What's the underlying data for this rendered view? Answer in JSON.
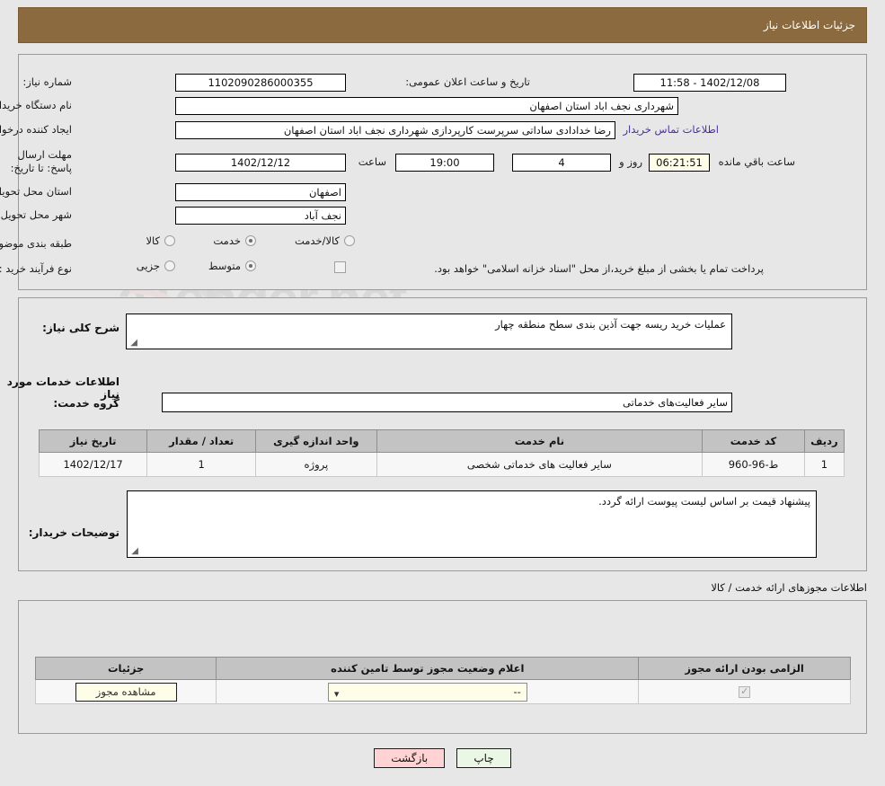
{
  "header": {
    "title": "جزئیات اطلاعات نیاز"
  },
  "top_form": {
    "need_number_label": "شماره نیاز:",
    "need_number_value": "1102090286000355",
    "announce_label": "تاریخ و ساعت اعلان عمومی:",
    "announce_value": "1402/12/08 - 11:58",
    "buyer_org_label": "نام دستگاه خریدار:",
    "buyer_org_value": "شهرداری نجف اباد استان اصفهان",
    "creator_label": "ایجاد کننده درخواست:",
    "creator_value": "رضا خدادادی ساداتی سرپرست  کارپردازی شهرداری نجف اباد استان اصفهان",
    "contact_link": "اطلاعات تماس خریدار",
    "deadline_label": "مهلت ارسال پاسخ: تا تاریخ:",
    "deadline_date": "1402/12/12",
    "hour_label": "ساعت",
    "deadline_time": "19:00",
    "days_value": "4",
    "days_label": "روز و",
    "remaining_value": "06:21:51",
    "remaining_label": "ساعت باقي مانده",
    "province_label": "استان محل تحویل:",
    "province_value": "اصفهان",
    "city_label": "شهر محل تحویل:",
    "city_value": "نجف آباد",
    "category_label": "طبقه بندی موضوعی:",
    "category_options": [
      {
        "label": "کالا",
        "selected": false
      },
      {
        "label": "خدمت",
        "selected": true
      },
      {
        "label": "کالا/خدمت",
        "selected": false
      }
    ],
    "process_label": "نوع فرآیند خرید :",
    "process_options": [
      {
        "label": "جزیی",
        "selected": false
      },
      {
        "label": "متوسط",
        "selected": true
      }
    ],
    "treasury_checkbox_text": "پرداخت تمام یا بخشی از مبلغ خرید،از محل \"اسناد خزانه اسلامی\" خواهد بود."
  },
  "mid": {
    "summary_label": "شرح کلی نیاز:",
    "summary_value": "عملیات خرید ریسه جهت آذین بندی سطح منطقه چهار",
    "services_heading": "اطلاعات خدمات مورد نیاز",
    "service_group_label": "گروه خدمت:",
    "service_group_value": "سایر فعالیت‌های خدماتی",
    "table": {
      "headers": [
        "ردیف",
        "کد خدمت",
        "نام خدمت",
        "واحد اندازه گیری",
        "تعداد / مقدار",
        "تاریخ نیاز"
      ],
      "rows": [
        [
          "1",
          "ط-96-960",
          "سایر فعالیت های خدماتی شخصی",
          "پروژه",
          "1",
          "1402/12/17"
        ]
      ]
    },
    "buyer_notes_label": "توضیحات خریدار:",
    "buyer_notes_value": "پیشنهاد قیمت بر اساس لیست پیوست ارائه گردد."
  },
  "permits": {
    "heading": "اطلاعات مجوزهای ارائه خدمت / کالا",
    "headers": [
      "الزامی بودن ارائه مجوز",
      "اعلام وضعیت مجوز توسط تامین کننده",
      "جزئیات"
    ],
    "rows": [
      {
        "required": true,
        "status": "--",
        "detail_button": "مشاهده مجوز"
      }
    ]
  },
  "footer": {
    "print_label": "چاپ",
    "back_label": "بازگشت"
  },
  "colors": {
    "header_bar": "#8a6a3e",
    "link": "#4b2fa0",
    "back_button": "#ffd3d3",
    "print_button": "#e9f7e4",
    "cream_field": "#fdfde8",
    "table_header": "#c3c3c3"
  }
}
